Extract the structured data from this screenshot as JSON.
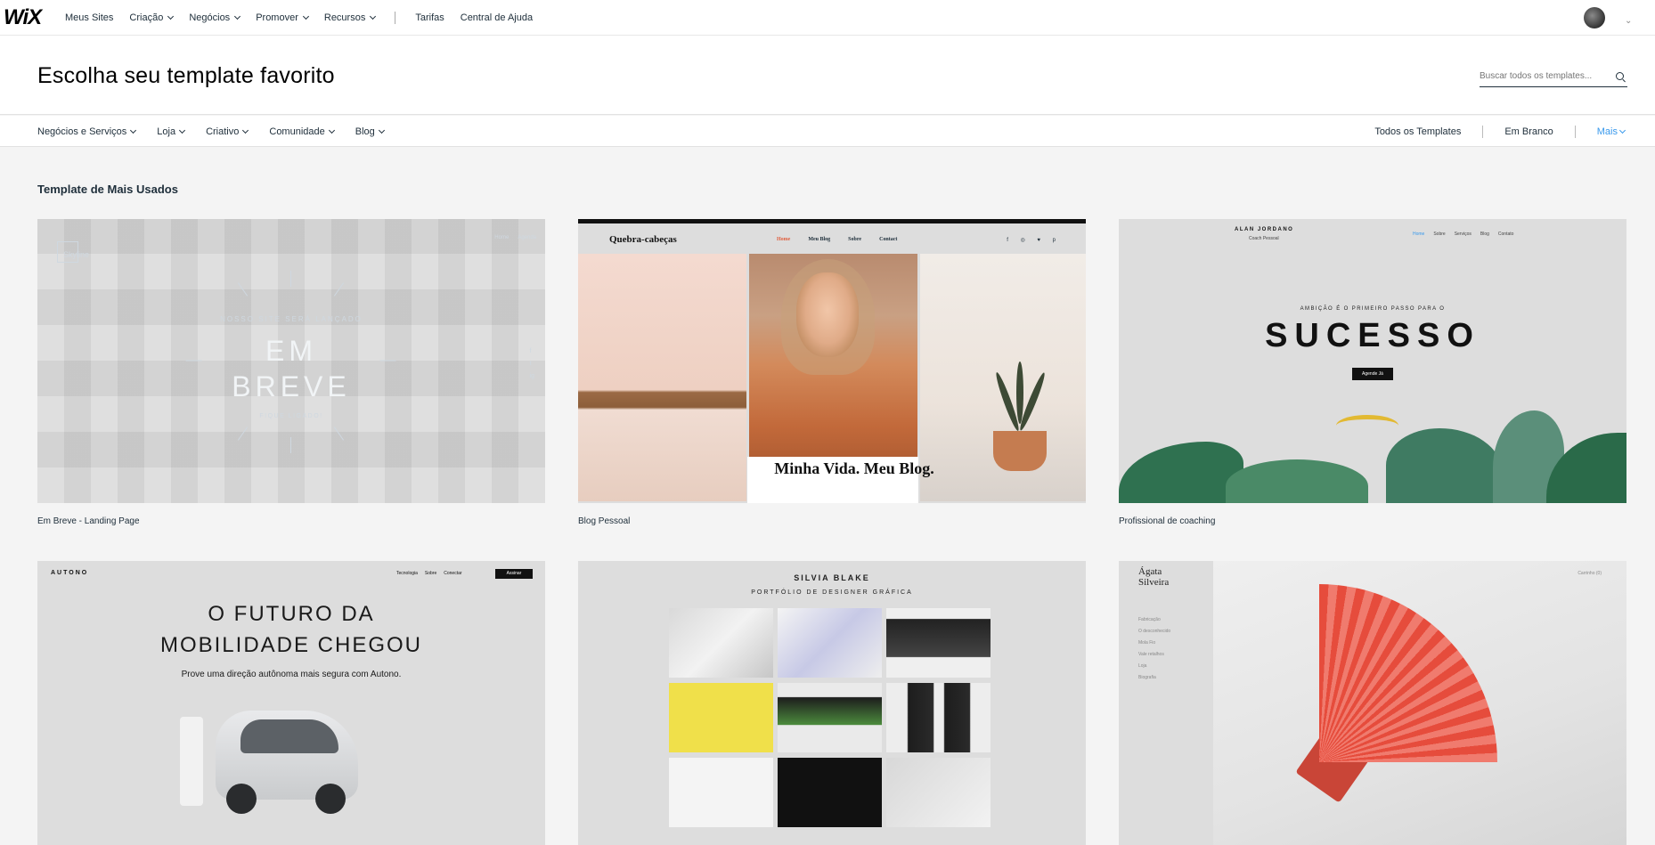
{
  "nav": {
    "logo": "WiX",
    "items": [
      "Meus Sites",
      "Criação",
      "Negócios",
      "Promover",
      "Recursos"
    ],
    "items_dropdown": [
      false,
      true,
      true,
      true,
      true
    ],
    "secondary": [
      "Tarifas",
      "Central de Ajuda"
    ]
  },
  "header": {
    "title": "Escolha seu template favorito",
    "search_placeholder": "Buscar todos os templates..."
  },
  "categories": {
    "left": [
      "Negócios e Serviços",
      "Loja",
      "Criativo",
      "Comunidade",
      "Blog"
    ],
    "right": [
      "Todos os Templates",
      "Em Branco"
    ],
    "more": "Mais"
  },
  "section": {
    "title": "Template de Mais Usados"
  },
  "templates": [
    {
      "name": "Em Breve - Landing Page",
      "preview": {
        "brand": "Skyline",
        "nav": [
          "Home",
          "Agenda"
        ],
        "subtitle": "NOSSO SITE SERÁ LANÇADO",
        "headline_1": "EM",
        "headline_2": "BREVE",
        "footer": "FIQUE LIGADO!",
        "social": [
          "f",
          "t",
          "ig"
        ]
      }
    },
    {
      "name": "Blog Pessoal",
      "preview": {
        "brand": "Quebra-cabeças",
        "nav": [
          "Home",
          "Meu Blog",
          "Sobre",
          "Contact"
        ],
        "social": "f ◎ ♥ p",
        "banner": "Minha Vida. Meu Blog."
      }
    },
    {
      "name": "Profissional de coaching",
      "preview": {
        "brand": "ALAN JORDANO",
        "tagline": "Coach Pessoal",
        "nav": [
          "Home",
          "Sobre",
          "Serviços",
          "Blog",
          "Contato"
        ],
        "subtitle": "AMBIÇÃO É O PRIMEIRO PASSO PARA O",
        "headline": "SUCESSO",
        "button": "Agende Já"
      }
    },
    {
      "name": "",
      "preview": {
        "brand": "AUTONO",
        "nav": [
          "Tecnologia",
          "Sobre",
          "Conectar"
        ],
        "button": "Assinar",
        "headline_1": "O FUTURO DA",
        "headline_2": "MOBILIDADE CHEGOU",
        "subtitle": "Prove uma direção autônoma mais segura com Autono."
      }
    },
    {
      "name": "",
      "preview": {
        "brand": "SILVIA BLAKE",
        "subtitle": "PORTFÓLIO DE DESIGNER GRÁFICA"
      }
    },
    {
      "name": "",
      "preview": {
        "brand_1": "Ágata",
        "brand_2": "Silveira",
        "menu": [
          "Fabricação",
          "O desconhecido",
          "Mola Fio",
          "Vale retalhos",
          "Loja",
          "Biografia"
        ],
        "cart": "Carrinho (0)"
      }
    }
  ],
  "colors": {
    "accent": "#3899ec",
    "text": "#20303c",
    "background": "#f4f4f4"
  }
}
